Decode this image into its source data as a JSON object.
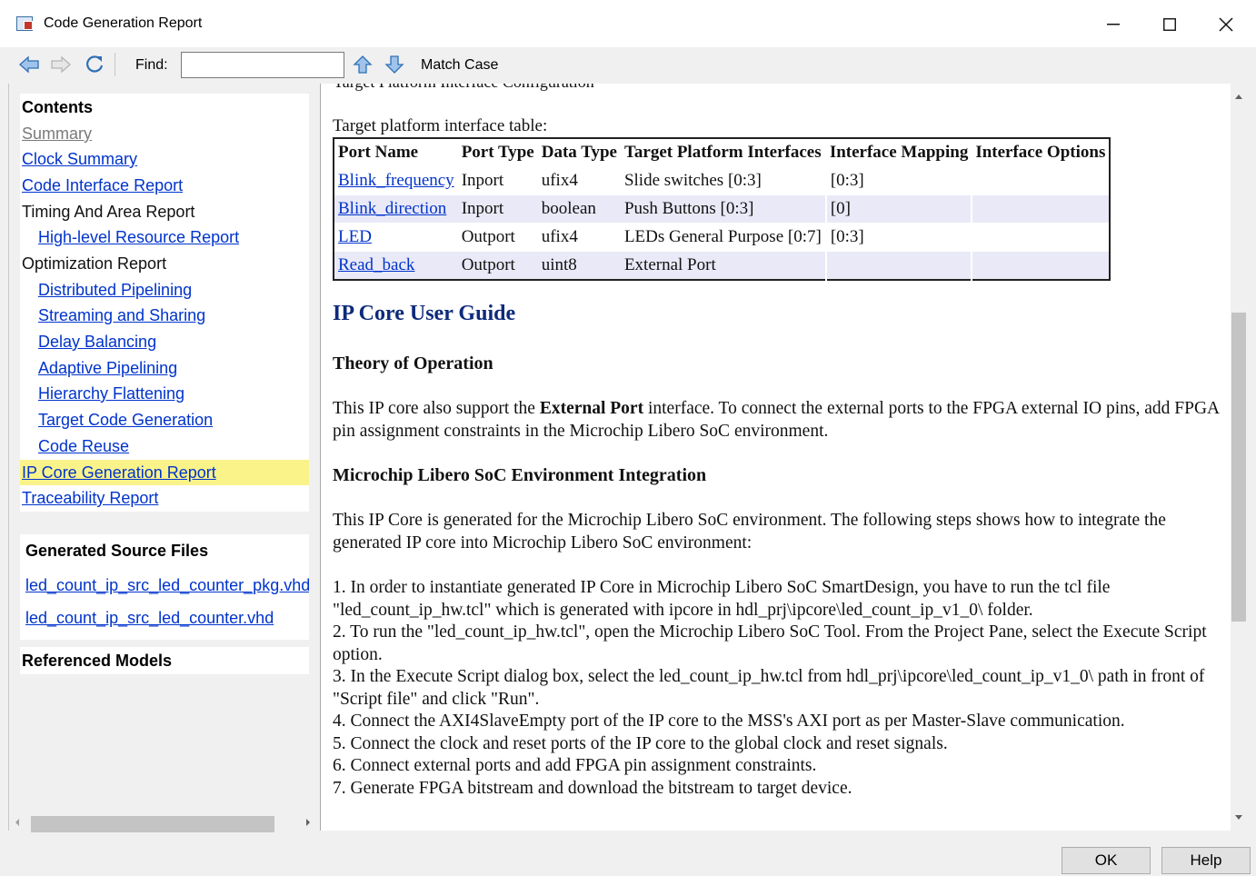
{
  "window": {
    "title": "Code Generation Report",
    "minimize_label": "—",
    "maximize_label": "☐",
    "close_label": "✕"
  },
  "toolbar": {
    "find_label": "Find:",
    "find_value": "",
    "match_case_label": "Match Case",
    "icons": [
      "back-arrow-icon",
      "forward-arrow-icon",
      "refresh-icon",
      "find-up-arrow-icon",
      "find-down-arrow-icon"
    ]
  },
  "sidebar": {
    "contents_heading": "Contents",
    "items": [
      {
        "label": "Summary",
        "style": "visited"
      },
      {
        "label": "Clock Summary",
        "style": "link"
      },
      {
        "label": "Code Interface Report",
        "style": "link"
      },
      {
        "label": "Timing And Area Report",
        "style": "plain"
      },
      {
        "label": "High-level Resource Report",
        "style": "link"
      },
      {
        "label": "Optimization Report",
        "style": "plain"
      },
      {
        "label": "Distributed Pipelining",
        "style": "link"
      },
      {
        "label": "Streaming and Sharing",
        "style": "link"
      },
      {
        "label": "Delay Balancing",
        "style": "link"
      },
      {
        "label": "Adaptive Pipelining",
        "style": "link"
      },
      {
        "label": "Hierarchy Flattening",
        "style": "link"
      },
      {
        "label": "Target Code Generation",
        "style": "link"
      },
      {
        "label": "Code Reuse",
        "style": "link"
      },
      {
        "label": "IP Core Generation Report",
        "style": "link"
      },
      {
        "label": "Traceability Report",
        "style": "link"
      }
    ],
    "generated_heading": "Generated Source Files",
    "generated_files": [
      "led_count_ip_src_led_counter_pkg.vhd",
      "led_count_ip_src_led_counter.vhd"
    ],
    "referenced_heading": "Referenced Models"
  },
  "content": {
    "cut_heading": "Target Platform Interface Configuration",
    "table_caption": "Target platform interface table:",
    "table": {
      "headers": [
        "Port Name",
        "Port Type",
        "Data Type",
        "Target Platform Interfaces",
        "Interface Mapping",
        "Interface Options"
      ],
      "rows": [
        [
          "Blink_frequency",
          "Inport",
          "ufix4",
          "Slide switches [0:3]",
          "[0:3]",
          ""
        ],
        [
          "Blink_direction",
          "Inport",
          "boolean",
          "Push Buttons [0:3]",
          "[0]",
          ""
        ],
        [
          "LED",
          "Outport",
          "ufix4",
          "LEDs General Purpose [0:7]",
          "[0:3]",
          ""
        ],
        [
          "Read_back",
          "Outport",
          "uint8",
          "External Port",
          "",
          ""
        ]
      ]
    },
    "user_guide_title": "IP Core User Guide",
    "theory_title": "Theory of Operation",
    "theory_pre": "This IP core also support the ",
    "theory_bold": "External Port",
    "theory_post": " interface. To connect the external ports to the FPGA external IO pins, add FPGA pin assignment constraints in the Microchip Libero SoC environment.",
    "integration_title": "Microchip Libero SoC Environment Integration",
    "integration_intro": "This IP Core is generated for the Microchip Libero SoC environment. The following steps shows how to integrate the generated IP core into Microchip Libero SoC environment:",
    "steps": [
      "1. In order to instantiate generated IP Core in Microchip Libero SoC SmartDesign, you have to run the tcl file \"led_count_ip_hw.tcl\" which is generated with ipcore in hdl_prj\\ipcore\\led_count_ip_v1_0\\ folder.",
      "2. To run the \"led_count_ip_hw.tcl\", open the Microchip Libero SoC Tool. From the Project Pane, select the Execute Script option.",
      "3. In the Execute Script dialog box, select the led_count_ip_hw.tcl from hdl_prj\\ipcore\\led_count_ip_v1_0\\ path in front of \"Script file\" and click \"Run\".",
      "4. Connect the AXI4SlaveEmpty port of the IP core to the MSS's AXI port as per Master-Slave communication.",
      "5. Connect the clock and reset ports of the IP core to the global clock and reset signals.",
      "6. Connect external ports and add FPGA pin assignment constraints.",
      "7. Generate FPGA bitstream and download the bitstream to target device."
    ]
  },
  "buttons": {
    "ok_label": "OK",
    "help_label": "Help"
  },
  "colors": {
    "highlight": "#faf38a",
    "link": "#0033cc",
    "table_alt_row": "#e9e9f7",
    "heading_blue": "#0d2a7a"
  }
}
